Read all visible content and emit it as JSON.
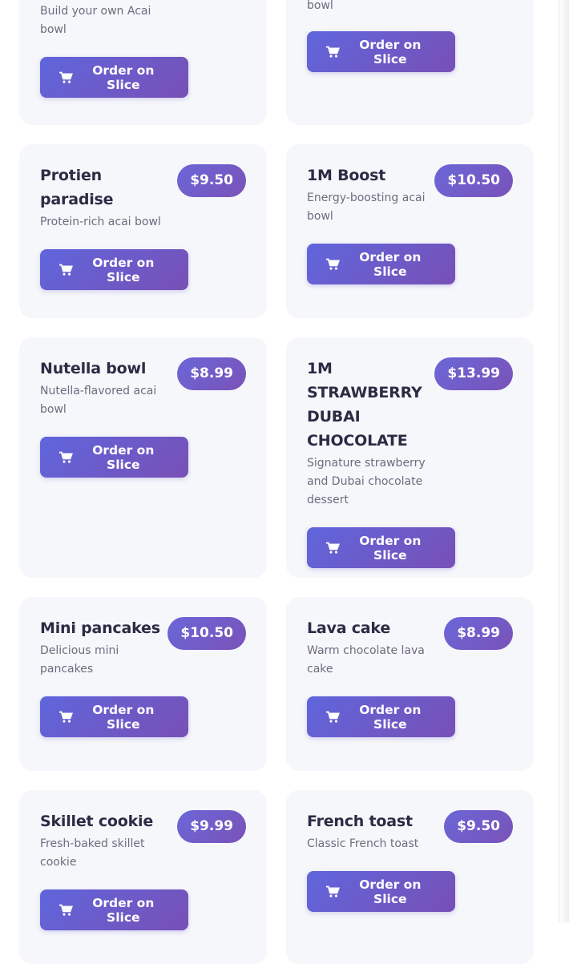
{
  "menu": {
    "button_label": "Order on Slice",
    "button_icon": "shopping-cart-icon",
    "accent_gradient": [
      "#5f66dc",
      "#7850b6"
    ],
    "items": [
      {
        "name": "",
        "price": "",
        "desc": "Build your own Acai bowl"
      },
      {
        "name": "",
        "price": "",
        "desc": "bowl"
      },
      {
        "name": "Protien paradise",
        "price": "$9.50",
        "desc": "Protein-rich acai bowl"
      },
      {
        "name": "1M Boost",
        "price": "$10.50",
        "desc": "Energy-boosting acai bowl"
      },
      {
        "name": "Nutella bowl",
        "price": "$8.99",
        "desc": "Nutella-flavored acai bowl"
      },
      {
        "name": "1M STRAWBERRY DUBAI CHOCOLATE",
        "price": "$13.99",
        "desc": "Signature strawberry and Dubai chocolate dessert"
      },
      {
        "name": "Mini pancakes",
        "price": "$10.50",
        "desc": "Delicious mini pancakes"
      },
      {
        "name": "Lava cake",
        "price": "$8.99",
        "desc": "Warm chocolate lava cake"
      },
      {
        "name": "Skillet cookie",
        "price": "$9.99",
        "desc": "Fresh-baked skillet cookie"
      },
      {
        "name": "French toast",
        "price": "$9.50",
        "desc": "Classic French toast"
      }
    ]
  }
}
